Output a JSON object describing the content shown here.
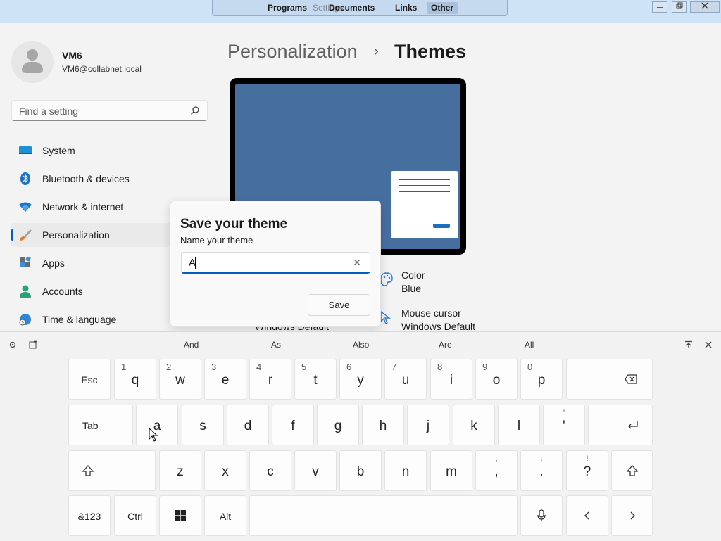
{
  "toolbar": {
    "menu": [
      "Programs",
      "Documents",
      "Links",
      "Other"
    ],
    "active_menu": "Other",
    "ghost_title": "Settings",
    "window_buttons": [
      "minimize",
      "restore",
      "close"
    ]
  },
  "user": {
    "name": "VM6",
    "email": "VM6@collabnet.local"
  },
  "search": {
    "placeholder": "Find a setting"
  },
  "sidebar": {
    "items": [
      {
        "label": "System",
        "icon": "system-icon"
      },
      {
        "label": "Bluetooth & devices",
        "icon": "bluetooth-icon"
      },
      {
        "label": "Network & internet",
        "icon": "wifi-icon"
      },
      {
        "label": "Personalization",
        "icon": "paintbrush-icon",
        "selected": true
      },
      {
        "label": "Apps",
        "icon": "apps-icon"
      },
      {
        "label": "Accounts",
        "icon": "accounts-icon"
      },
      {
        "label": "Time & language",
        "icon": "globe-clock-icon"
      }
    ]
  },
  "breadcrumb": {
    "parent": "Personalization",
    "separator": "›",
    "current": "Themes"
  },
  "options": {
    "color_title": "Color",
    "color_value": "Blue",
    "cursor_title": "Mouse cursor",
    "cursor_value": "Windows Default",
    "partial_text": "Windows Default"
  },
  "dialog": {
    "title": "Save your theme",
    "label": "Name your theme",
    "input_value": "A",
    "save_label": "Save"
  },
  "keyboard": {
    "suggestions": [
      "And",
      "As",
      "Also",
      "Are",
      "All"
    ],
    "row1": [
      {
        "main": "Esc"
      },
      {
        "main": "q",
        "sec": "1"
      },
      {
        "main": "w",
        "sec": "2"
      },
      {
        "main": "e",
        "sec": "3"
      },
      {
        "main": "r",
        "sec": "4"
      },
      {
        "main": "t",
        "sec": "5"
      },
      {
        "main": "y",
        "sec": "6"
      },
      {
        "main": "u",
        "sec": "7"
      },
      {
        "main": "i",
        "sec": "8"
      },
      {
        "main": "o",
        "sec": "9"
      },
      {
        "main": "p",
        "sec": "0"
      }
    ],
    "row2": [
      {
        "main": "Tab"
      },
      {
        "main": "a"
      },
      {
        "main": "s"
      },
      {
        "main": "d"
      },
      {
        "main": "f"
      },
      {
        "main": "g"
      },
      {
        "main": "h"
      },
      {
        "main": "j"
      },
      {
        "main": "k"
      },
      {
        "main": "l"
      },
      {
        "main": "'",
        "top": "\""
      }
    ],
    "row3": [
      {
        "main": "z"
      },
      {
        "main": "x"
      },
      {
        "main": "c"
      },
      {
        "main": "v"
      },
      {
        "main": "b"
      },
      {
        "main": "n"
      },
      {
        "main": "m"
      },
      {
        "main": ",",
        "top": ";"
      },
      {
        "main": ".",
        "top": ":"
      },
      {
        "main": "?",
        "top": "!"
      }
    ],
    "row4": [
      {
        "main": "&123"
      },
      {
        "main": "Ctrl"
      },
      {
        "main": "Alt"
      }
    ]
  }
}
